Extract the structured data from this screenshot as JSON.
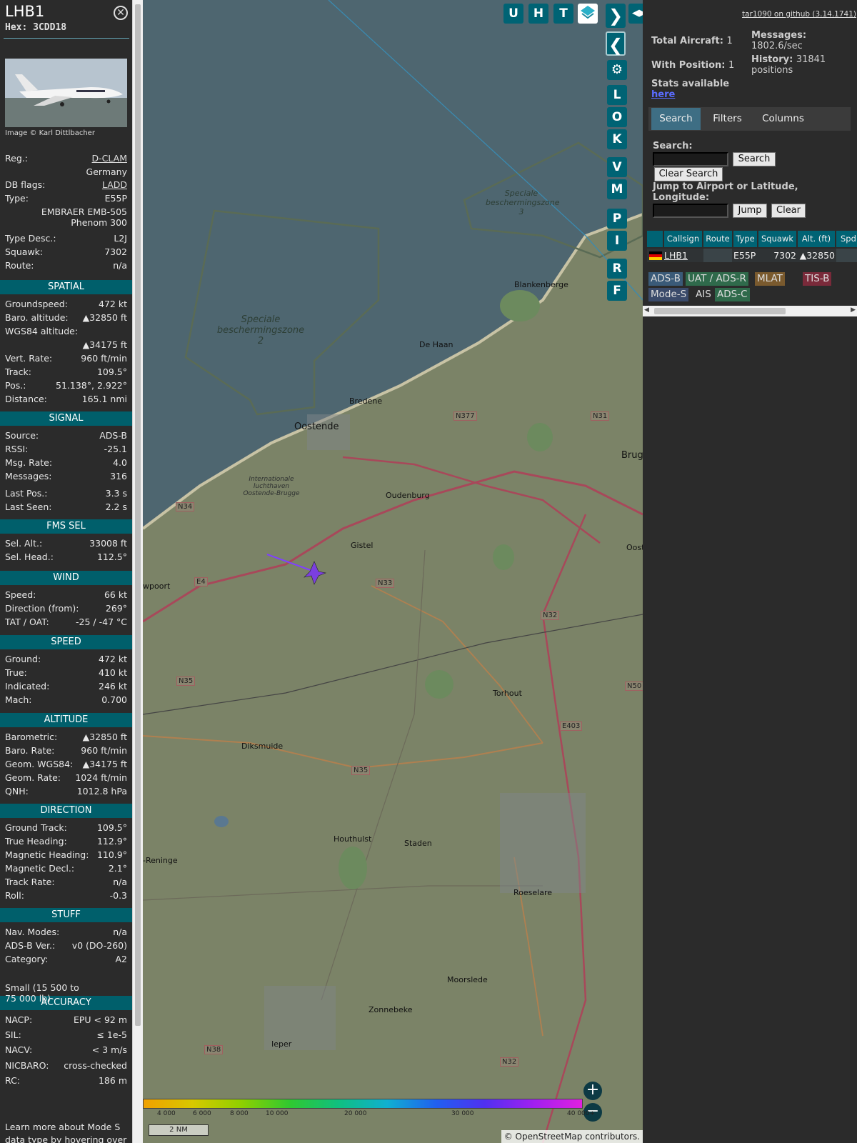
{
  "sidebar": {
    "callsign": "LHB1",
    "hex": "Hex: 3CDD18",
    "photo_credit": "Image © Karl Dittlbacher",
    "info": {
      "reg_label": "Reg.:",
      "reg": "D-CLAM",
      "country": "Germany",
      "dbflags_label": "DB flags:",
      "dbflags": "LADD",
      "type_label": "Type:",
      "type": "E55P",
      "type_name1": "EMBRAER EMB-505",
      "type_name2": "Phenom 300",
      "typedesc_label": "Type Desc.:",
      "typedesc": "L2J",
      "squawk_label": "Squawk:",
      "squawk": "7302",
      "route_label": "Route:",
      "route": "n/a"
    },
    "sections": {
      "spatial": "SPATIAL",
      "signal": "SIGNAL",
      "fms": "FMS SEL",
      "wind": "WIND",
      "speed": "SPEED",
      "altitude": "ALTITUDE",
      "direction": "DIRECTION",
      "stuff": "STUFF",
      "accuracy": "ACCURACY"
    },
    "spatial": [
      {
        "k": "Groundspeed:",
        "v": "472 kt"
      },
      {
        "k": "Baro. altitude:",
        "v": "▲32850 ft"
      },
      {
        "k": "WGS84 altitude:",
        "v": ""
      },
      {
        "k": "",
        "v": "▲34175 ft"
      },
      {
        "k": "Vert. Rate:",
        "v": "960 ft/min"
      },
      {
        "k": "Track:",
        "v": "109.5°"
      },
      {
        "k": "Pos.:",
        "v": "51.138°, 2.922°"
      },
      {
        "k": "Distance:",
        "v": "165.1 nmi"
      }
    ],
    "signal": [
      {
        "k": "Source:",
        "v": "ADS-B"
      },
      {
        "k": "RSSI:",
        "v": "-25.1"
      },
      {
        "k": "Msg. Rate:",
        "v": "4.0"
      },
      {
        "k": "Messages:",
        "v": "316"
      },
      {
        "k": "Last Pos.:",
        "v": "3.3 s"
      },
      {
        "k": "Last Seen:",
        "v": "2.2 s"
      }
    ],
    "fms": [
      {
        "k": "Sel. Alt.:",
        "v": "33008 ft"
      },
      {
        "k": "Sel. Head.:",
        "v": "112.5°"
      }
    ],
    "wind": [
      {
        "k": "Speed:",
        "v": "66 kt"
      },
      {
        "k": "Direction (from):",
        "v": "269°"
      },
      {
        "k": "TAT / OAT:",
        "v": "-25 / -47 °C"
      }
    ],
    "speed": [
      {
        "k": "Ground:",
        "v": "472 kt"
      },
      {
        "k": "True:",
        "v": "410 kt"
      },
      {
        "k": "Indicated:",
        "v": "246 kt"
      },
      {
        "k": "Mach:",
        "v": "0.700"
      }
    ],
    "altitude": [
      {
        "k": "Barometric:",
        "v": "▲32850 ft"
      },
      {
        "k": "Baro. Rate:",
        "v": "960 ft/min"
      },
      {
        "k": "Geom. WGS84:",
        "v": "▲34175 ft"
      },
      {
        "k": "Geom. Rate:",
        "v": "1024 ft/min"
      },
      {
        "k": "QNH:",
        "v": "1012.8 hPa"
      }
    ],
    "direction": [
      {
        "k": "Ground Track:",
        "v": "109.5°"
      },
      {
        "k": "True Heading:",
        "v": "112.9°"
      },
      {
        "k": "Magnetic Heading:",
        "v": "110.9°"
      },
      {
        "k": "Magnetic Decl.:",
        "v": "2.1°"
      },
      {
        "k": "Track Rate:",
        "v": "n/a"
      },
      {
        "k": "Roll:",
        "v": "-0.3"
      }
    ],
    "stuff": [
      {
        "k": "Nav. Modes:",
        "v": "n/a"
      },
      {
        "k": "ADS-B Ver.:",
        "v": "v0 (DO-260)"
      },
      {
        "k": "Category:",
        "v": "A2"
      }
    ],
    "category_desc1": "Small (15 500 to",
    "category_desc2": "75 000 lb)",
    "accuracy": [
      {
        "k": "NACP:",
        "v": "EPU < 92 m"
      },
      {
        "k": "SIL:",
        "v": "≤ 1e-5"
      },
      {
        "k": "NACV:",
        "v": "< 3 m/s"
      },
      {
        "k": "NICBARO:",
        "v": "cross-checked"
      },
      {
        "k": "RC:",
        "v": "186 m"
      }
    ],
    "footer1": "Learn more about Mode S",
    "footer2": "data type by hovering over"
  },
  "map": {
    "buttons_top": [
      "U",
      "H",
      "T"
    ],
    "side_buttons": [
      "L",
      "O",
      "K",
      "V",
      "M",
      "P",
      "I",
      "R",
      "F"
    ],
    "places": [
      "Blankenberge",
      "De Haan",
      "Bredene",
      "Oostende",
      "Brug",
      "Oudenburg",
      "Gistel",
      "Torhout",
      "Diksmuide",
      "Houthulst",
      "Staden",
      "Roeselare",
      "Moorslede",
      "Zonnebeke",
      "Ieper",
      "-Reninge",
      "wpoort",
      "Oost"
    ],
    "roads": [
      "N377",
      "N31",
      "N34",
      "N33",
      "N32",
      "N35",
      "E403",
      "N35",
      "N38",
      "N32",
      "N50",
      "E4"
    ],
    "zone_labels": [
      "Speciale beschermingszone 2",
      "Speciale beschermingszone 3"
    ],
    "airport_label": "Internationale luchthaven Oostende-Brugge",
    "alt_scale": [
      "4 000",
      "6 000",
      "8 000",
      "10 000",
      "20 000",
      "30 000",
      "40 000+"
    ],
    "scale_label": "2 NM",
    "attribution": "© OpenStreetMap contributors."
  },
  "panel": {
    "github": "tar1090 on github (3.14.1741)",
    "total_label": "Total Aircraft:",
    "total": "1",
    "withpos_label": "With Position:",
    "withpos": "1",
    "messages_label": "Messages:",
    "messages": "1802.6/sec",
    "history_label": "History:",
    "history": "31841 positions",
    "stats_label": "Stats available",
    "stats_link": "here",
    "tabs": [
      "Search",
      "Filters",
      "Columns"
    ],
    "search_label": "Search:",
    "search_btn": "Search",
    "clear_search_btn": "Clear Search",
    "jump_label": "Jump to Airport or Latitude, Longitude:",
    "jump_btn": "Jump",
    "clear_btn": "Clear",
    "columns": [
      "Callsign",
      "Route",
      "Type",
      "Squawk",
      "Alt. (ft)",
      "Spd"
    ],
    "rows": [
      {
        "callsign": "LHB1",
        "route": "",
        "type": "E55P",
        "squawk": "7302",
        "alt": "▲32850",
        "spd": ""
      }
    ],
    "sources": [
      "ADS-B",
      "UAT / ADS-R",
      "MLAT",
      "TIS-B",
      "Mode-S",
      "AIS",
      "ADS-C"
    ],
    "source_colors": {
      "ADS-B": "#3a5a78",
      "UAT / ADS-R": "#2f6a4b",
      "MLAT": "#7a5a2e",
      "TIS-B": "#7a2a3a",
      "Mode-S": "#3a4a6a",
      "AIS": "#2b2b2b",
      "ADS-C": "#2f6a4b"
    }
  },
  "colors": {
    "accent": "#005f6b",
    "panel_bg": "#2b2b2b",
    "map_water": "#4e6670",
    "map_land": "#7b8367",
    "track": "#8040ff"
  }
}
